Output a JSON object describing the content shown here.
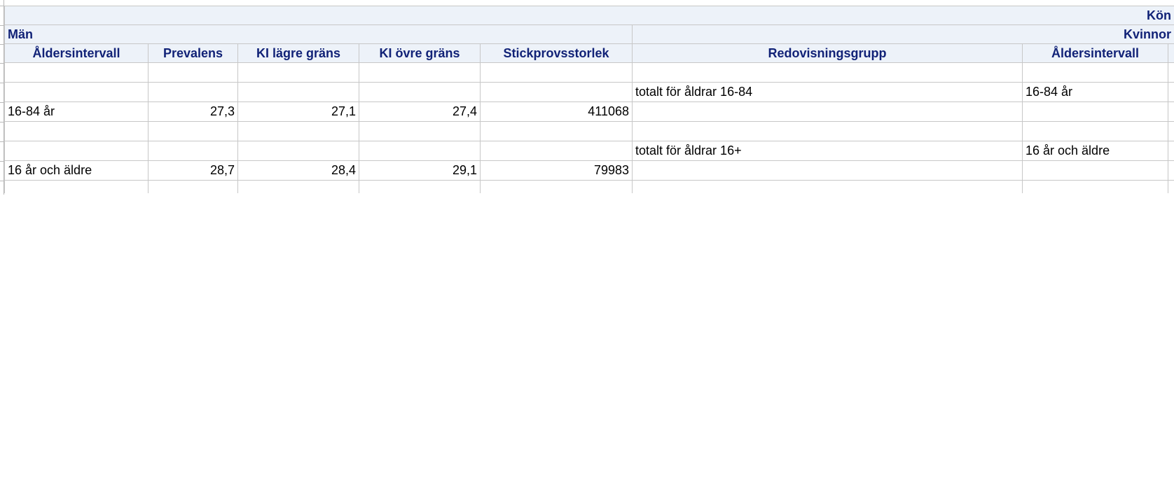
{
  "table": {
    "top_header": "Kön",
    "groups": {
      "men": "Män",
      "women": "Kvinnor"
    },
    "columns": [
      "Åldersintervall",
      "Prevalens",
      "KI lägre gräns",
      "KI övre gräns",
      "Stickprovsstorlek",
      "Redovisningsgrupp",
      "Åldersintervall"
    ],
    "rows": [
      [
        "",
        "",
        "",
        "",
        "",
        "",
        ""
      ],
      [
        "",
        "",
        "",
        "",
        "",
        "totalt för åldrar 16-84",
        "16-84 år"
      ],
      [
        "16-84 år",
        "27,3",
        "27,1",
        "27,4",
        "411068",
        "",
        ""
      ],
      [
        "",
        "",
        "",
        "",
        "",
        "",
        ""
      ],
      [
        "",
        "",
        "",
        "",
        "",
        "totalt för åldrar 16+",
        "16 år och äldre"
      ],
      [
        "16 år och äldre",
        "28,7",
        "28,4",
        "29,1",
        "79983",
        "",
        ""
      ],
      [
        "",
        "",
        "",
        "",
        "",
        "",
        ""
      ]
    ]
  },
  "colors": {
    "header_bg": "#edf2f9",
    "header_text": "#112277",
    "grid_line": "#c7c7c7"
  }
}
